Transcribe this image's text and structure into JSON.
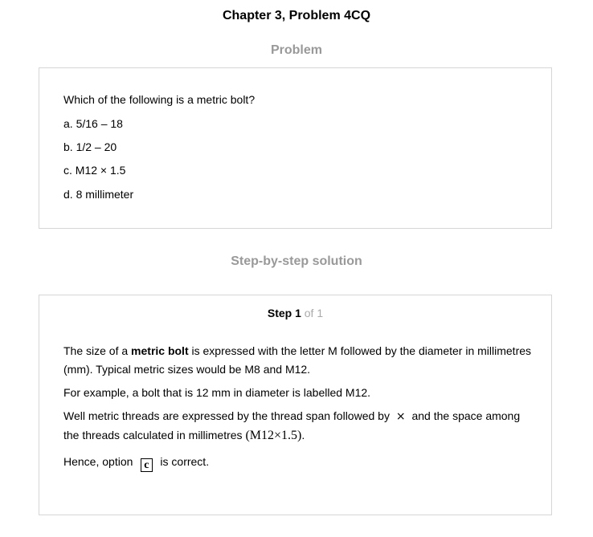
{
  "page": {
    "title": "Chapter 3, Problem 4CQ",
    "problem_heading": "Problem",
    "solution_heading": "Step-by-step solution"
  },
  "problem": {
    "question": "Which of the following is a metric bolt?",
    "options": [
      "a. 5/16 – 18",
      "b. 1/2 – 20",
      "c. M12 × 1.5",
      "d. 8 millimeter"
    ]
  },
  "solution": {
    "step_word": "Step 1",
    "step_of": "of 1",
    "para1_pre": "The size of a ",
    "para1_bold": "metric bolt",
    "para1_post": " is expressed with the letter M followed by the diameter in millimetres (mm). Typical metric sizes would be M8 and M12.",
    "para2": "For example, a bolt that is 12 mm in diameter is labelled M12.",
    "para3_pre": "Well metric threads are expressed by the thread span followed by ",
    "para3_symbol": "×",
    "para3_mid": " and the space among the threads calculated in millimetres ",
    "para3_math": "(M12×1.5)",
    "para3_end": ".",
    "para4_pre": "Hence, option ",
    "para4_answer": "c",
    "para4_post": " is correct."
  }
}
